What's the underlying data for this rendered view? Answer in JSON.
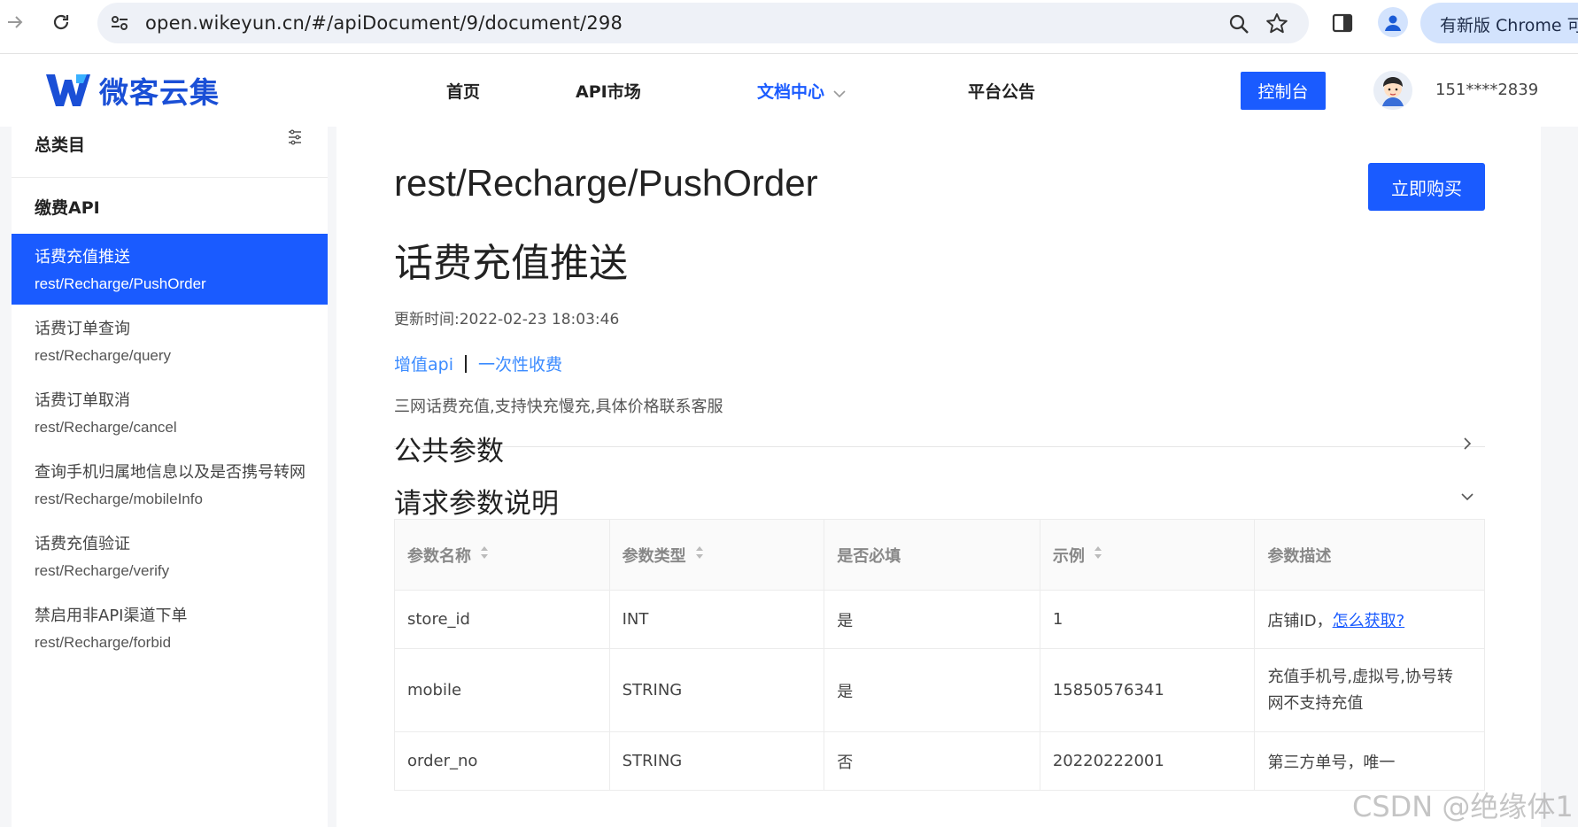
{
  "browser": {
    "url": "open.wikeyun.cn/#/apiDocument/9/document/298",
    "update_text": "有新版 Chrome 可用"
  },
  "header": {
    "logo_text": "微客云集",
    "nav": [
      {
        "label": "首页"
      },
      {
        "label": "API市场"
      },
      {
        "label": "文档中心"
      },
      {
        "label": "平台公告"
      }
    ],
    "console_label": "控制台",
    "user_phone": "151****2839"
  },
  "sidebar": {
    "category_title": "总类目",
    "group_title": "缴费API",
    "items": [
      {
        "zh": "话费充值推送",
        "en": "rest/Recharge/PushOrder",
        "active": true
      },
      {
        "zh": "话费订单查询",
        "en": "rest/Recharge/query"
      },
      {
        "zh": "话费订单取消",
        "en": "rest/Recharge/cancel"
      },
      {
        "zh": "查询手机归属地信息以及是否携号转网",
        "en": "rest/Recharge/mobileInfo"
      },
      {
        "zh": "话费充值验证",
        "en": "rest/Recharge/verify"
      },
      {
        "zh": "禁启用非API渠道下单",
        "en": "rest/Recharge/forbid"
      }
    ]
  },
  "main": {
    "api_path": "rest/Recharge/PushOrder",
    "buy_label": "立即购买",
    "api_title": "话费充值推送",
    "updated": "更新时间:2022-02-23 18:03:46",
    "tags": [
      "增值api",
      "一次性收费"
    ],
    "description": "三网话费充值,支持快充慢充,具体价格联系客服",
    "section_public": "公共参数",
    "section_request": "请求参数说明",
    "table": {
      "headers": [
        "参数名称",
        "参数类型",
        "是否必填",
        "示例",
        "参数描述"
      ],
      "rows": [
        {
          "name": "store_id",
          "type": "INT",
          "required": "是",
          "example": "1",
          "desc_prefix": "店铺ID，",
          "desc_link": "怎么获取?"
        },
        {
          "name": "mobile",
          "type": "STRING",
          "required": "是",
          "example": "15850576341",
          "desc_line1": "充值手机号,虚拟号,协号转",
          "desc_line2": "网不支持充值"
        },
        {
          "name": "order_no",
          "type": "STRING",
          "required": "否",
          "example": "20220222001",
          "desc": "第三方单号，唯一"
        }
      ]
    }
  },
  "watermark": "CSDN @绝缘体1"
}
